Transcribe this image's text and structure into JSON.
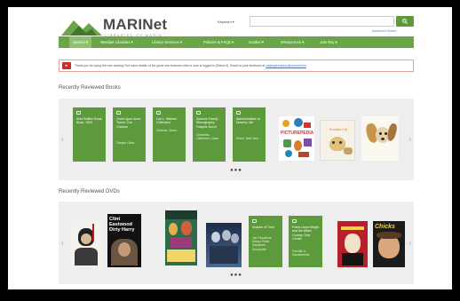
{
  "brand": {
    "name": "MARINet",
    "tagline": "LIBRARIES OF MARIN"
  },
  "header": {
    "search_scope": "Keyword",
    "search_placeholder": "",
    "advanced_link": "Advanced Search"
  },
  "nav": {
    "items": [
      {
        "label": "Search ▾"
      },
      {
        "label": "Member Libraries ▾"
      },
      {
        "label": "Library Services ▾"
      },
      {
        "label": "Policies & FAQs ▾"
      },
      {
        "label": "Guides ▾"
      },
      {
        "label": "eResources ▾"
      },
      {
        "label": "Join Rsy ▾"
      }
    ]
  },
  "alert": {
    "text": "Thank you for trying the new catalog! Get some details of the great new features when a user is logged in (Select it). Email us your feedback at",
    "link": "catalogfeedback@marinet.info"
  },
  "books": {
    "title": "Recently Reviewed Books",
    "cards": [
      {
        "title": "Kids Rutline Book, Book, 1900",
        "author": ""
      },
      {
        "title": "Once Upon Anne Tamm, Our Chicken",
        "author": "Oregon Dahn"
      },
      {
        "title": "Lori L. Walmer Collection",
        "author": "Ghmlwa, Boren"
      },
      {
        "title": "Science Family Stenography Graphic Novel",
        "author": "Clements, Catherine, Lelan"
      },
      {
        "title": "Administrative of Nursery Life",
        "author": "Ersen, Mell Tanlr"
      }
    ],
    "covers": [
      {
        "title": "PICTUREPEDIA"
      },
      {
        "title": "Rudolph Cat"
      },
      {
        "title": ""
      }
    ]
  },
  "dvds": {
    "title": "Recently Reviewed DVDs",
    "covers_left": [
      {
        "title": ""
      },
      {
        "title": "Clint Eastwood Dirty Harry"
      },
      {
        "title": ""
      },
      {
        "title": ""
      }
    ],
    "cards": [
      {
        "title": "Shaolin of Time",
        "author": "Jac Pasadena Danyu Paulo Departure Sunnyvale"
      },
      {
        "title": "Frank Lloyd Wright and the Marin County Civic Center",
        "author": "Presidio & Departments"
      }
    ],
    "covers_right": [
      {
        "title": ""
      },
      {
        "title": "Chicks"
      }
    ]
  },
  "pagination": {
    "dots": "●●●"
  },
  "colors": {
    "brand_green": "#5c9a3c",
    "nav_green": "#6aa648",
    "alert_red": "#c62f2f"
  }
}
